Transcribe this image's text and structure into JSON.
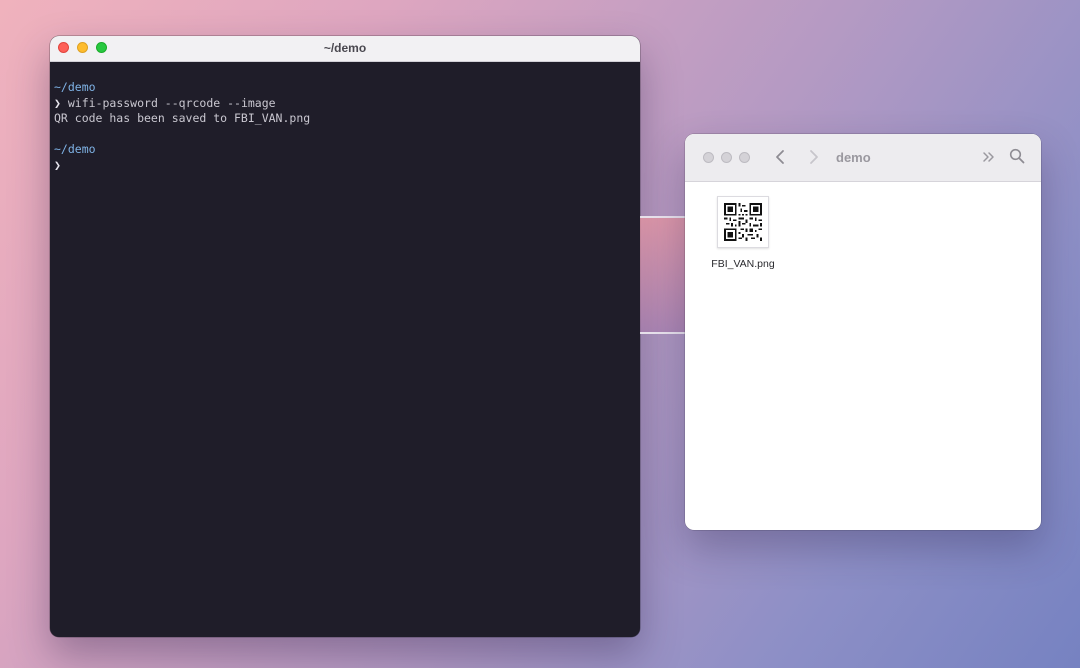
{
  "terminal": {
    "title": "~/demo",
    "lines": [
      {
        "kind": "dir",
        "text": "~/demo"
      },
      {
        "kind": "command",
        "prompt": "❯",
        "text": "wifi-password --qrcode --image"
      },
      {
        "kind": "output",
        "text": "QR code has been saved to FBI_VAN.png"
      },
      {
        "kind": "blank",
        "text": ""
      },
      {
        "kind": "dir",
        "text": "~/demo"
      },
      {
        "kind": "command",
        "prompt": "❯",
        "text": ""
      }
    ]
  },
  "finder": {
    "title": "demo",
    "icons": {
      "back": "chevron-left-icon",
      "forward": "chevron-right-icon",
      "more": "double-chevron-right-icon",
      "search": "search-icon"
    },
    "files": [
      {
        "name": "FBI_VAN.png",
        "thumbnail": "qr-code-icon"
      }
    ]
  },
  "colors": {
    "terminal_bg": "#1f1d29",
    "terminal_dir": "#7fb3e6",
    "traffic_red": "#fe5f57",
    "traffic_yellow": "#febc2e",
    "traffic_green": "#28c840"
  }
}
